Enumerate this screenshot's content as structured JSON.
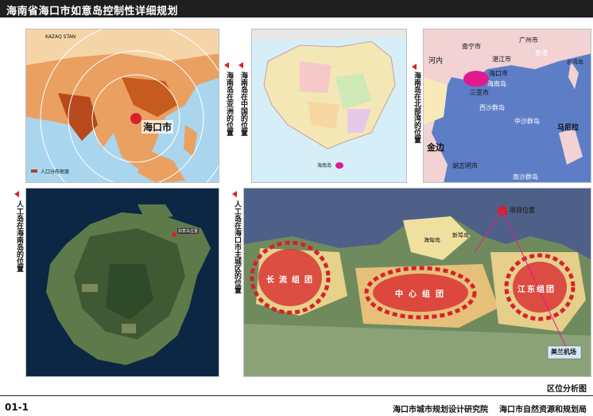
{
  "header": {
    "title": "海南省海口市如意岛控制性详细规划"
  },
  "panels": {
    "asia": {
      "label": "海南岛在亚洲的位置",
      "city_label": "海口市",
      "country_label": "KAZAQ STAN",
      "legend_label": "人口分布密度"
    },
    "china": {
      "label": "海南岛在中国的位置",
      "island_label": "海南岛"
    },
    "gulf": {
      "label": "海南岛在北部湾的位置",
      "places": [
        "南宁市",
        "广州市",
        "香港",
        "海口市",
        "海南岛",
        "三亚市",
        "中沙群岛",
        "西沙群岛",
        "马尼拉",
        "金边",
        "胡志明市",
        "南沙群岛",
        "台湾岛",
        "湛江市",
        "河内"
      ]
    },
    "island": {
      "label": "人工岛在海南岛的位置",
      "marker_label": "如意岛位置"
    },
    "city": {
      "label": "人工岛在海口市主城区的位置",
      "project_label": "项目位置",
      "airport_label": "美兰机场",
      "groups": [
        "长流组团",
        "中心组团",
        "江东组团"
      ],
      "district_label": "海甸岛",
      "district_label2": "新埠岛"
    }
  },
  "footer": {
    "page_number": "01-1",
    "analysis_title": "区位分析图",
    "institutions": "海口市城市规划设计研究院    海口市自然资源和规划局"
  },
  "colors": {
    "accent_red": "#d8202a",
    "title_bg": "#1f1f1f",
    "island_magenta": "#e0198f"
  }
}
